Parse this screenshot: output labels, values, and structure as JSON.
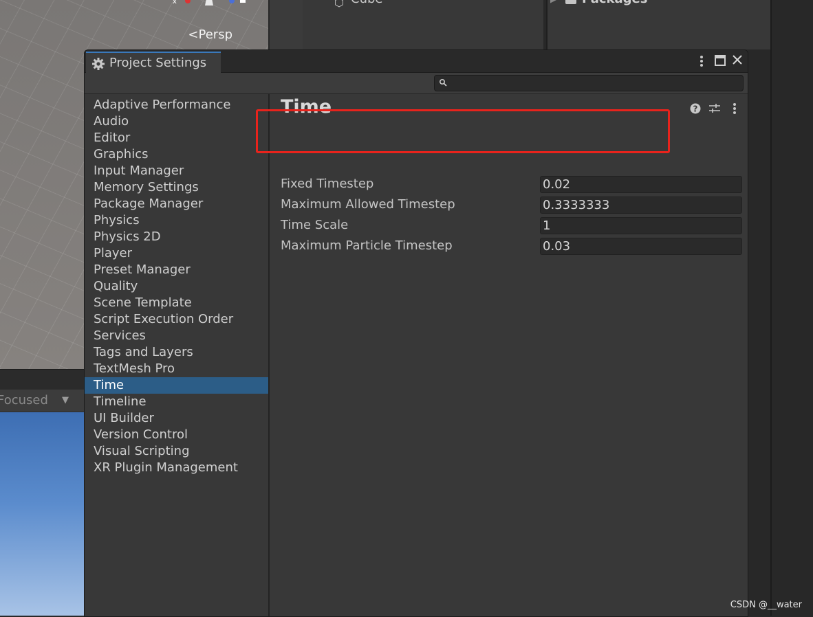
{
  "scene": {
    "persp_label": "Persp",
    "focused_label": "Focused"
  },
  "hierarchy": {
    "item_label": "Cube"
  },
  "project": {
    "folder_label": "Packages"
  },
  "window": {
    "title": "Project Settings",
    "search_placeholder": "",
    "search_value": ""
  },
  "sidebar": {
    "items": [
      {
        "label": "Adaptive Performance"
      },
      {
        "label": "Audio"
      },
      {
        "label": "Editor"
      },
      {
        "label": "Graphics"
      },
      {
        "label": "Input Manager"
      },
      {
        "label": "Memory Settings"
      },
      {
        "label": "Package Manager"
      },
      {
        "label": "Physics"
      },
      {
        "label": "Physics 2D"
      },
      {
        "label": "Player"
      },
      {
        "label": "Preset Manager"
      },
      {
        "label": "Quality"
      },
      {
        "label": "Scene Template"
      },
      {
        "label": "Script Execution Order"
      },
      {
        "label": "Services"
      },
      {
        "label": "Tags and Layers"
      },
      {
        "label": "TextMesh Pro"
      },
      {
        "label": "Time"
      },
      {
        "label": "Timeline"
      },
      {
        "label": "UI Builder"
      },
      {
        "label": "Version Control"
      },
      {
        "label": "Visual Scripting"
      },
      {
        "label": "XR Plugin Management"
      }
    ],
    "selected": "Time"
  },
  "content": {
    "title": "Time",
    "fields": [
      {
        "label": "Fixed Timestep",
        "value": "0.02"
      },
      {
        "label": "Maximum Allowed Timestep",
        "value": "0.3333333"
      },
      {
        "label": "Time Scale",
        "value": "1"
      },
      {
        "label": "Maximum Particle Timestep",
        "value": "0.03"
      }
    ]
  },
  "annotation": {
    "color": "#e8231c"
  },
  "colors": {
    "selection": "#2c5d87",
    "tab_accent": "#3a79bb"
  },
  "watermark": "CSDN @__water"
}
